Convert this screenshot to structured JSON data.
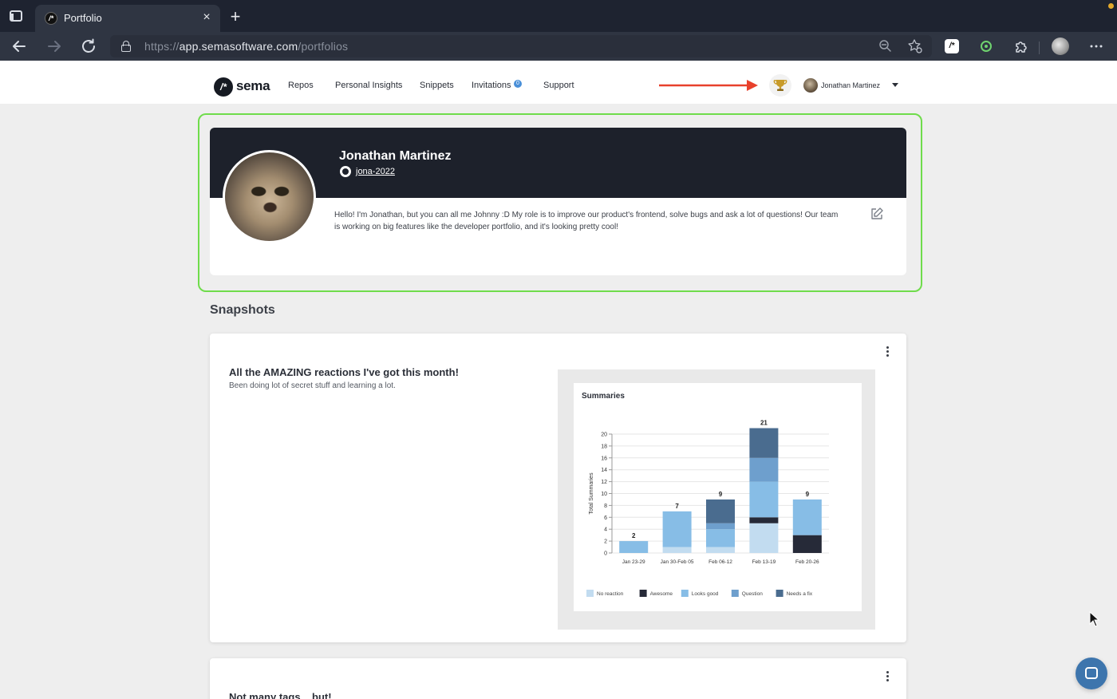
{
  "browser": {
    "tab_title": "Portfolio",
    "tab_favicon": "/*",
    "close_glyph": "×",
    "new_tab_glyph": "+",
    "url_scheme": "https://",
    "url_host": "app.semasoftware.com",
    "url_path": "/portfolios",
    "icons": [
      "window-icon",
      "back-icon",
      "forward-icon",
      "refresh-icon",
      "lock-icon",
      "zoom-out-icon",
      "add-favorite-icon",
      "sema-extension-icon",
      "green-extension-icon",
      "puzzle-extension-icon",
      "profile-avatar-icon",
      "more-icon"
    ]
  },
  "app": {
    "logo_text": "sema",
    "logo_mark": "/*",
    "nav": [
      "Repos",
      "Personal Insights",
      "Snippets",
      "Invitations",
      "Support"
    ],
    "invitations_badge": "0",
    "user_name": "Jonathan Martinez",
    "trophy_icon": "trophy-icon"
  },
  "profile": {
    "name": "Jonathan Martinez",
    "github_handle": "jona-2022",
    "bio": "Hello! I'm Jonathan, but you can all me Johnny :D My role is to improve our product's frontend, solve bugs and ask a lot of questions! Our team is working on big features like the developer portfolio, and it's looking pretty cool!"
  },
  "snapshots": {
    "section_title": "Snapshots",
    "items": [
      {
        "title": "All the AMAZING reactions I've got this month!",
        "description": "Been doing lot of secret stuff and learning a lot."
      },
      {
        "title": "Not many tags... but!",
        "description": ""
      }
    ]
  },
  "chart_data": {
    "type": "bar",
    "stacked": true,
    "title": "Summaries",
    "xlabel": "",
    "ylabel": "Total Summaries",
    "ylim": [
      0,
      20
    ],
    "yticks": [
      0,
      2,
      4,
      6,
      8,
      10,
      12,
      14,
      16,
      18,
      20
    ],
    "categories": [
      "Jan 23-29",
      "Jan 30-Feb 05",
      "Feb 06-12",
      "Feb 13-19",
      "Feb 20-26"
    ],
    "totals": [
      2,
      7,
      9,
      21,
      9
    ],
    "series": [
      {
        "name": "No reaction",
        "color": "#c2dcf0",
        "values": [
          0,
          1,
          1,
          5,
          0
        ]
      },
      {
        "name": "Awesome",
        "color": "#262a38",
        "values": [
          0,
          0,
          0,
          1,
          3
        ]
      },
      {
        "name": "Looks good",
        "color": "#87bde6",
        "values": [
          2,
          6,
          3,
          6,
          6
        ]
      },
      {
        "name": "Question",
        "color": "#6e9fcd",
        "values": [
          0,
          0,
          1,
          4,
          0
        ]
      },
      {
        "name": "Needs a fix",
        "color": "#4a6c8f",
        "values": [
          0,
          0,
          4,
          5,
          0
        ]
      }
    ],
    "legend_position": "bottom",
    "grid": true
  }
}
